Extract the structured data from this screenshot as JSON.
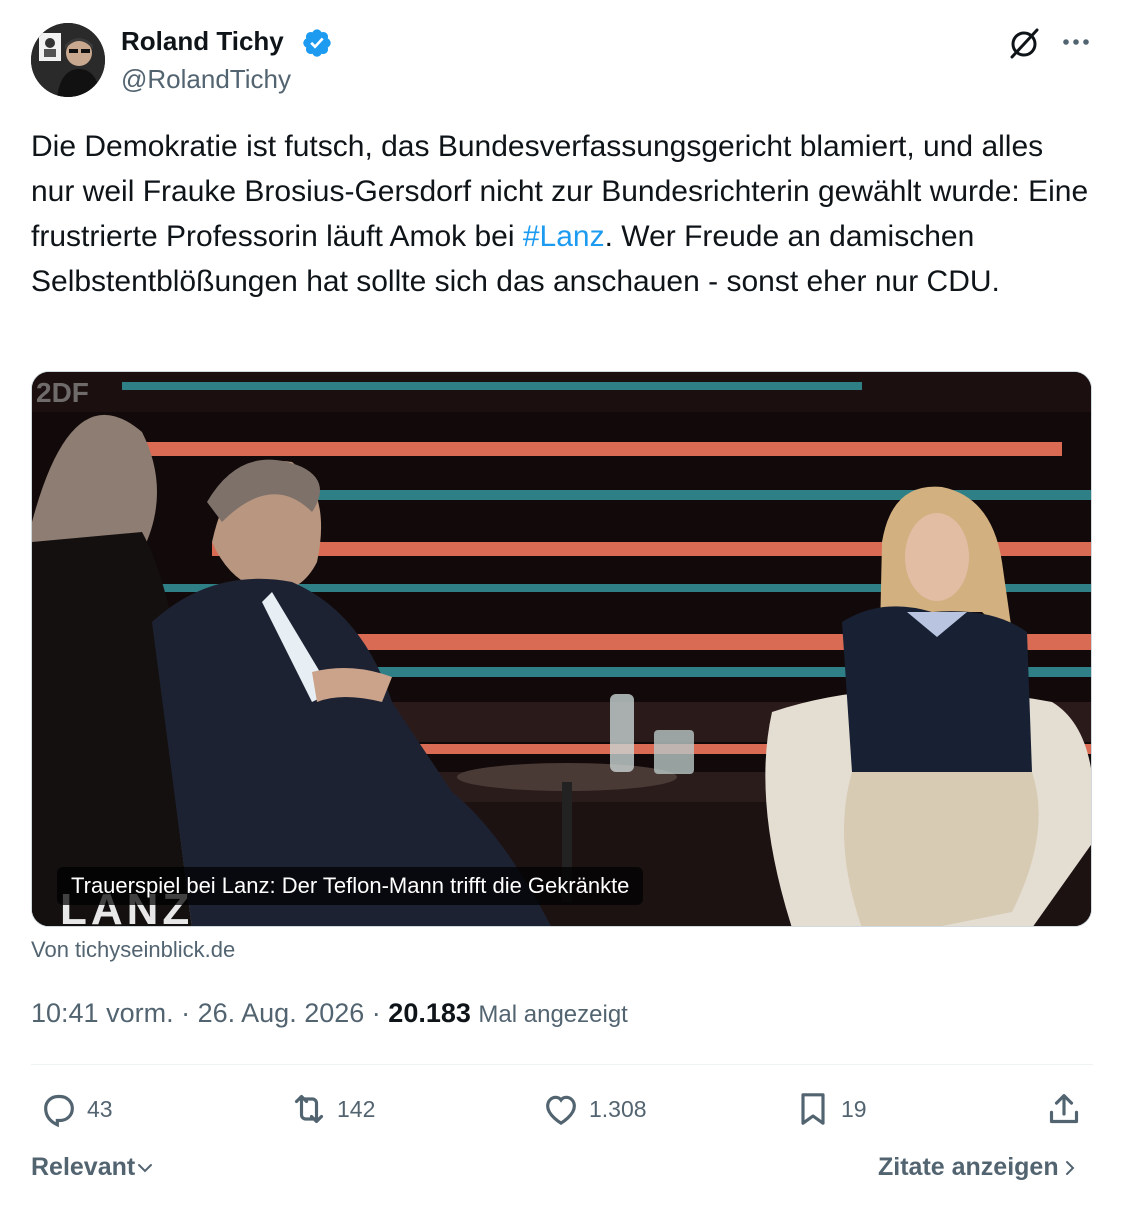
{
  "author": {
    "name": "Roland Tichy",
    "handle": "@RolandTichy"
  },
  "tweet": {
    "text_before": "Die Demokratie ist futsch, das Bundesverfassungsgericht blamiert, und alles nur weil Frauke Brosius-Gersdorf nicht zur Bundesrichterin gewählt wurde: Eine frustrierte Professorin läuft Amok bei ",
    "hashtag": "#Lanz",
    "text_after": ". Wer Freude an damischen Selbstentblößungen hat sollte sich das anschauen - sonst eher nur CDU."
  },
  "media": {
    "caption": "Trauerspiel bei Lanz: Der Teflon-Mann trifft die Gekränkte",
    "source": "Von tichyseinblick.de",
    "overlay_logo": "LANZ",
    "channel_logo": "2DF"
  },
  "meta": {
    "time": "10:41 vorm.",
    "separator": "·",
    "date": "26. Aug. 2026",
    "views_count": "20.183",
    "views_label": "Mal angezeigt"
  },
  "actions": {
    "replies": "43",
    "reposts": "142",
    "likes": "1.308",
    "bookmarks": "19"
  },
  "footer": {
    "sort_label": "Relevant",
    "quotes_label": "Zitate anzeigen"
  },
  "colors": {
    "accent": "#1d9bf0",
    "text_primary": "#0f1419",
    "text_secondary": "#536471"
  },
  "icons": [
    "verified-badge-icon",
    "grok-icon",
    "more-icon",
    "reply-icon",
    "repost-icon",
    "like-icon",
    "bookmark-icon",
    "share-icon",
    "chevron-down-icon",
    "chevron-right-icon"
  ]
}
